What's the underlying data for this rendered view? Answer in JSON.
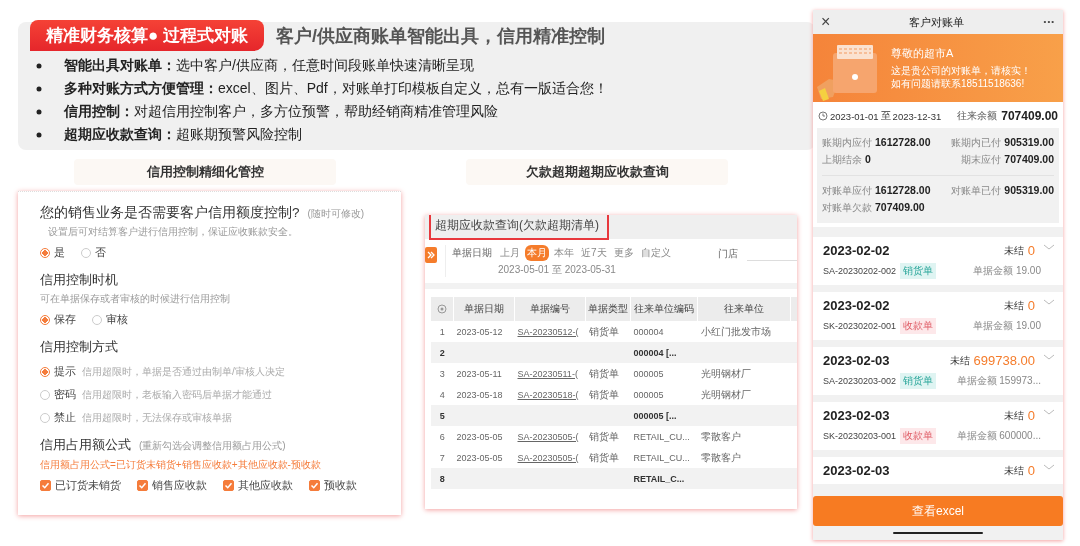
{
  "header": {
    "badge": "精准财务核算● 过程式对账",
    "title": "客户/供应商账单智能出具，信用精准控制",
    "bullets": [
      {
        "label": "智能出具对账单：",
        "text": "选中客户/供应商，任意时间段账单快速清晰呈现"
      },
      {
        "label": "多种对账方式方便管理：",
        "text": "excel、图片、Pdf，对账单打印模板自定义，总有一版适合您！"
      },
      {
        "label": "信用控制：",
        "text": "对超信用控制客户，多方位预警，帮助经销商精准管理风险"
      },
      {
        "label": "超期应收款查询：",
        "text": "超账期预警风险控制"
      }
    ]
  },
  "captions": [
    "信用控制精细化管控",
    "欠款超期超期应收款查询"
  ],
  "credit_panel": {
    "sections": [
      {
        "kind": "radio",
        "title": "您的销售业务是否需要客户信用额度控制?",
        "note": "(随时可修改)",
        "hint": "设置后可对结算客户进行信用控制，保证应收账款安全。",
        "options": [
          {
            "label": "是",
            "selected": true
          },
          {
            "label": "否",
            "selected": false
          }
        ]
      },
      {
        "kind": "radio",
        "title": "信用控制时机",
        "hint": "可在单据保存或者审核的时候进行信用控制",
        "options": [
          {
            "label": "保存",
            "selected": true
          },
          {
            "label": "审核",
            "selected": false
          }
        ]
      },
      {
        "kind": "radio",
        "title": "信用控制方式",
        "options": [
          {
            "label": "提示",
            "desc": "信用超限时，单据是否通过由制单/审核人决定",
            "selected": true
          },
          {
            "label": "密码",
            "desc": "信用超限时，老板输入密码后单据才能通过",
            "selected": false
          },
          {
            "label": "禁止",
            "desc": "信用超限时，无法保存或审核单据",
            "selected": false
          }
        ]
      },
      {
        "kind": "checkbox",
        "title": "信用占用额公式",
        "note": "(重新勾选会调整信用额占用公式)",
        "formula": "信用额占用公式=已订货未销货+销售应收款+其他应收款-预收款",
        "options": [
          {
            "label": "已订货未销货",
            "checked": true
          },
          {
            "label": "销售应收款",
            "checked": true
          },
          {
            "label": "其他应收款",
            "checked": true
          },
          {
            "label": "预收款",
            "checked": true
          }
        ]
      }
    ]
  },
  "overdue_panel": {
    "title": "超期应收款查询(欠款超期清单)",
    "filter": {
      "label": "单据日期",
      "chips": [
        {
          "label": "上月",
          "selected": false
        },
        {
          "label": "本月",
          "selected": true
        },
        {
          "label": "本年",
          "selected": false
        },
        {
          "label": "近7天",
          "selected": false
        },
        {
          "label": "更多",
          "selected": false
        },
        {
          "label": "自定义",
          "selected": false
        }
      ],
      "range": "2023-05-01 至 2023-05-31",
      "store_label": "门店"
    },
    "table": {
      "columns": [
        "单据日期",
        "单据编号",
        "单据类型",
        "往来单位编码",
        "往来单位"
      ],
      "rows": [
        {
          "kind": "item",
          "index": "1",
          "cells": [
            "2023-05-12",
            "SA-20230512-(",
            "销货单",
            "000004",
            "小红门批发市场"
          ]
        },
        {
          "kind": "subtotal",
          "index": "2",
          "cells": [
            "",
            "",
            "",
            "000004 [...",
            ""
          ]
        },
        {
          "kind": "item",
          "index": "3",
          "cells": [
            "2023-05-11",
            "SA-20230511-(",
            "销货单",
            "000005",
            "光明钢材厂"
          ]
        },
        {
          "kind": "item",
          "index": "4",
          "cells": [
            "2023-05-18",
            "SA-20230518-(",
            "销货单",
            "000005",
            "光明钢材厂"
          ]
        },
        {
          "kind": "subtotal",
          "index": "5",
          "cells": [
            "",
            "",
            "",
            "000005 [...",
            ""
          ]
        },
        {
          "kind": "item",
          "index": "6",
          "cells": [
            "2023-05-05",
            "SA-20230505-(",
            "销货单",
            "RETAIL_CU...",
            "零散客户"
          ]
        },
        {
          "kind": "item",
          "index": "7",
          "cells": [
            "2023-05-05",
            "SA-20230505-(",
            "销货单",
            "RETAIL_CU...",
            "零散客户"
          ]
        },
        {
          "kind": "subtotal",
          "index": "8",
          "cells": [
            "",
            "",
            "",
            "RETAIL_C...",
            ""
          ]
        }
      ]
    }
  },
  "phone": {
    "title": "客户对账单",
    "close": "×",
    "more": "•••",
    "banner": {
      "greeting": "尊敬的超市A",
      "lines": [
        "这是贵公司的对账单，请核实！",
        "如有问题请联系18511518636!"
      ]
    },
    "period": {
      "start": "2023-01-01",
      "sep": "至",
      "end": "2023-12-31",
      "balance_label": "往来余额",
      "balance": "707409.00"
    },
    "summary": [
      [
        {
          "label": "账期内应付",
          "value": "1612728.00"
        },
        {
          "label": "账期内已付",
          "value": "905319.00"
        }
      ],
      [
        {
          "label": "上期结余",
          "value": "0"
        },
        {
          "label": "期末应付",
          "value": "707409.00"
        }
      ],
      [
        {
          "label": "对账单应付",
          "value": "1612728.00"
        },
        {
          "label": "对账单已付",
          "value": "905319.00"
        }
      ],
      [
        {
          "label": "对账单欠款",
          "value": "707409.00"
        }
      ]
    ],
    "entries": [
      {
        "date": "2023-02-02",
        "status": "未结",
        "amount": "0",
        "number": "SA-20230202-002",
        "type": "销货单",
        "kind": "sale",
        "total": "单据金额 19.00"
      },
      {
        "date": "2023-02-02",
        "status": "未结",
        "amount": "0",
        "number": "SK-20230202-001",
        "type": "收款单",
        "kind": "receipt",
        "total": "单据金额 19.00"
      },
      {
        "date": "2023-02-03",
        "status": "未结",
        "amount": "699738.00",
        "number": "SA-20230203-002",
        "type": "销货单",
        "kind": "sale",
        "total": "单据金额 159973..."
      },
      {
        "date": "2023-02-03",
        "status": "未结",
        "amount": "0",
        "number": "SK-20230203-001",
        "type": "收款单",
        "kind": "receipt",
        "total": "单据金额 600000..."
      },
      {
        "date": "2023-02-03",
        "status": "未结",
        "amount": "0"
      }
    ],
    "button": "查看excel"
  }
}
